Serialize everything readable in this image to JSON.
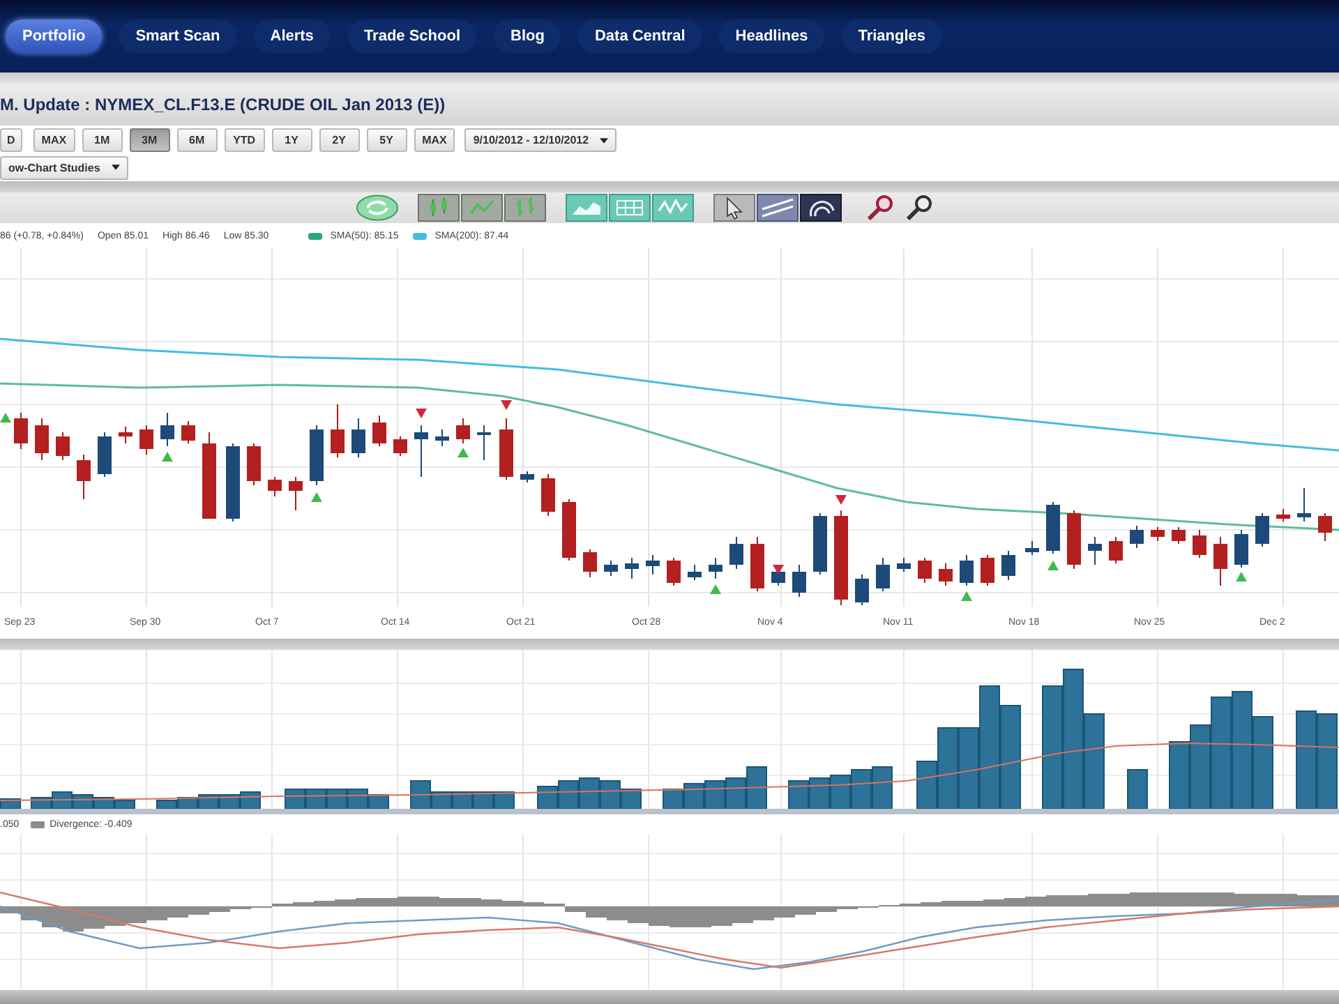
{
  "nav": {
    "tabs": [
      {
        "label": "Portfolio",
        "selected": true
      },
      {
        "label": "Smart Scan",
        "selected": false
      },
      {
        "label": "Alerts",
        "selected": false
      },
      {
        "label": "Trade School",
        "selected": false
      },
      {
        "label": "Blog",
        "selected": false
      },
      {
        "label": "Data Central",
        "selected": false
      },
      {
        "label": "Headlines",
        "selected": false
      },
      {
        "label": "Triangles",
        "selected": false
      }
    ]
  },
  "chart_title": "M. Update : NYMEX_CL.F13.E (CRUDE OIL Jan 2013 (E))",
  "range_buttons": [
    {
      "label": "D",
      "selected": false
    },
    {
      "label": "MAX",
      "selected": false
    },
    {
      "label": "1M",
      "selected": false
    },
    {
      "label": "3M",
      "selected": true
    },
    {
      "label": "6M",
      "selected": false
    },
    {
      "label": "YTD",
      "selected": false
    },
    {
      "label": "1Y",
      "selected": false
    },
    {
      "label": "2Y",
      "selected": false
    },
    {
      "label": "5Y",
      "selected": false
    },
    {
      "label": "MAX",
      "selected": false
    }
  ],
  "date_range": {
    "value": "9/10/2012 - 12/10/2012"
  },
  "studies_dropdown": {
    "value": "ow-Chart Studies"
  },
  "price_chart": {
    "quote": [
      "86 (+0.78, +0.84%)",
      "Open 85.01",
      "High 86.46",
      "Low 85.30"
    ],
    "legend": [
      {
        "label": "SMA(50): 85.15",
        "color": "#2ba57e"
      },
      {
        "label": "SMA(200): 87.44",
        "color": "#45bde0"
      }
    ],
    "x_labels": [
      "Sep 23",
      "Sep 30",
      "Oct 7",
      "Oct 14",
      "Oct 21",
      "Oct 28",
      "Nov 4",
      "Nov 11",
      "Nov 18",
      "Nov 25",
      "Dec 2"
    ]
  },
  "divergence_panel": {
    "scale_label": ".050",
    "legend": [
      {
        "label": "Divergence: -0.409",
        "color": "#8c8c8c"
      }
    ]
  }
}
